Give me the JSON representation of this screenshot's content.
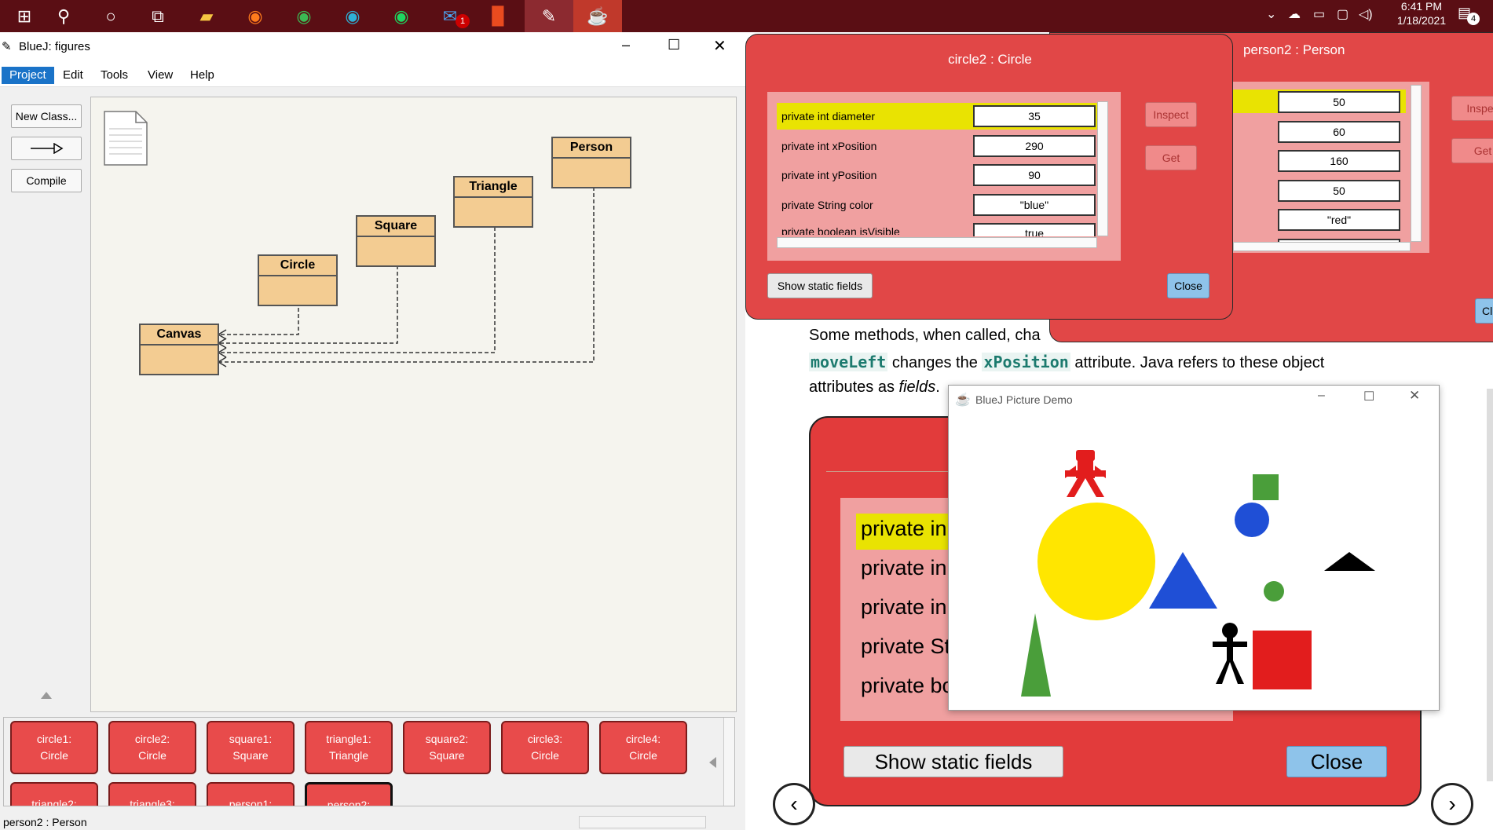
{
  "taskbar": {
    "badges": {
      "mail": "1",
      "notifications": "4"
    },
    "time": "6:41 PM",
    "date": "1/18/2021"
  },
  "bluej": {
    "title": "BlueJ:  figures",
    "menus": [
      "Project",
      "Edit",
      "Tools",
      "View",
      "Help"
    ],
    "buttons": {
      "new_class": "New Class...",
      "compile": "Compile"
    },
    "classes": {
      "person": "Person",
      "triangle": "Triangle",
      "square": "Square",
      "circle": "Circle",
      "canvas": "Canvas"
    },
    "objects": [
      {
        "l1": "circle1:",
        "l2": "Circle"
      },
      {
        "l1": "circle2:",
        "l2": "Circle"
      },
      {
        "l1": "square1:",
        "l2": "Square"
      },
      {
        "l1": "triangle1:",
        "l2": "Triangle"
      },
      {
        "l1": "square2:",
        "l2": "Square"
      },
      {
        "l1": "circle3:",
        "l2": "Circle"
      },
      {
        "l1": "circle4:",
        "l2": "Circle"
      },
      {
        "l1": "triangle2:",
        "l2": ""
      },
      {
        "l1": "triangle3:",
        "l2": ""
      },
      {
        "l1": "person1:",
        "l2": ""
      },
      {
        "l1": "person2:",
        "l2": ""
      }
    ],
    "status": "person2 : Person"
  },
  "inspector_circle": {
    "title": "circle2 : Circle",
    "fields": [
      {
        "name": "private int diameter",
        "value": "35"
      },
      {
        "name": "private int xPosition",
        "value": "290"
      },
      {
        "name": "private int yPosition",
        "value": "90"
      },
      {
        "name": "private String color",
        "value": "\"blue\""
      },
      {
        "name": "private boolean isVisible",
        "value": "true"
      }
    ],
    "inspect": "Inspect",
    "get": "Get",
    "show_static": "Show static fields",
    "close": "Close"
  },
  "inspector_person": {
    "title": "person2 : Person",
    "values": [
      "50",
      "60",
      "160",
      "50",
      "\"red\"",
      "true"
    ],
    "inspect": "Inspec",
    "get": "Get",
    "close": "Cl"
  },
  "tutorial": {
    "line1": "Some methods, when called, cha",
    "line2_code1": "moveLeft",
    "line2_mid": " changes the ",
    "line2_code2": "xPosition",
    "line2_end": " attribute. Java refers to these object",
    "line3_pre": "attributes as ",
    "line3_em": "fields",
    "line3_post": ".",
    "big_fields": [
      "private in",
      "private in",
      "private in",
      "private St",
      "private bo"
    ],
    "big_show_static": "Show static fields",
    "big_close": "Close"
  },
  "demo": {
    "title": "BlueJ Picture Demo"
  },
  "colors": {
    "yellow": "#ffe600",
    "blue": "#1f4fd6",
    "green": "#4a9e3a",
    "red": "#e21d1d",
    "black": "#000000"
  }
}
